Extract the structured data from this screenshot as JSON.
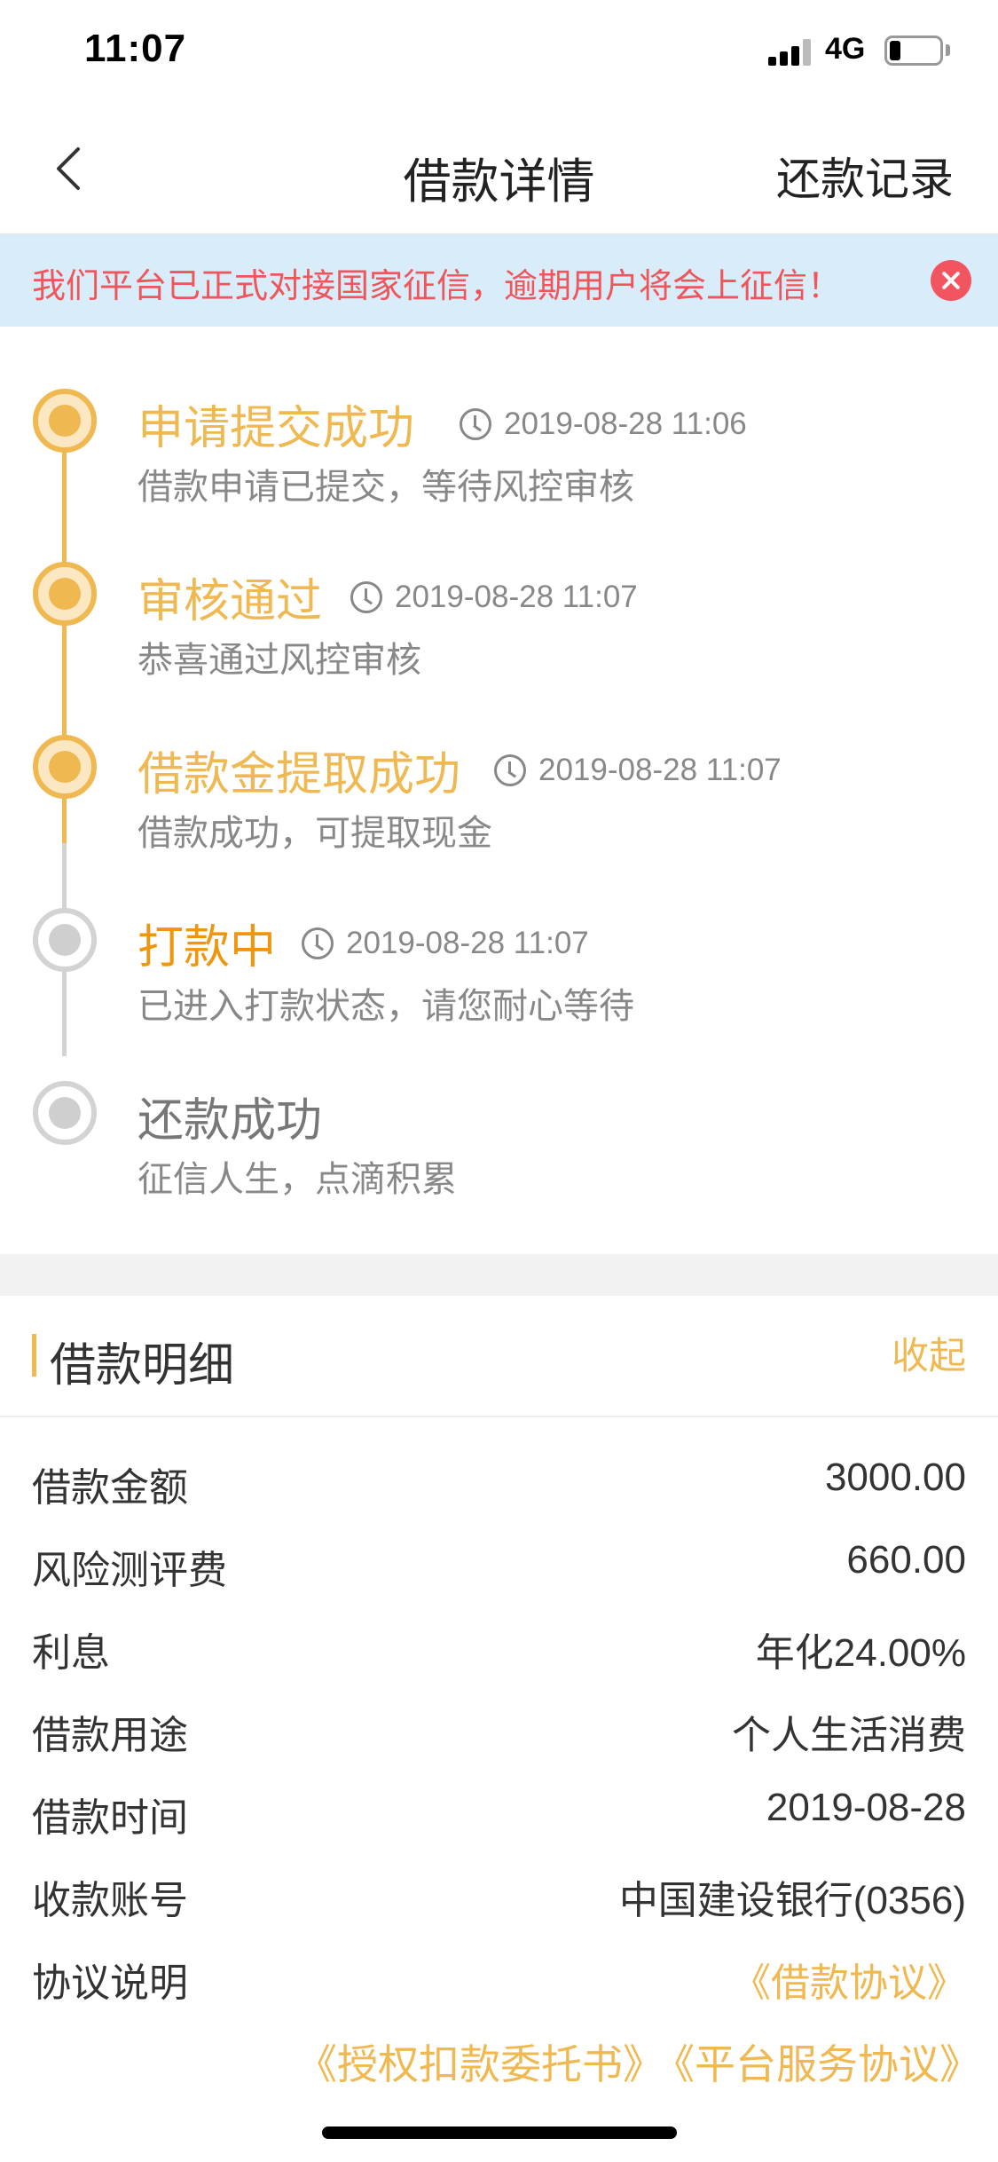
{
  "status_bar": {
    "time": "11:07",
    "network": "4G"
  },
  "nav": {
    "title": "借款详情",
    "right_action": "还款记录"
  },
  "notice": {
    "text": "我们平台已正式对接国家征信，逾期用户将会上征信！"
  },
  "timeline": [
    {
      "title": "申请提交成功",
      "time": "2019-08-28 11:06",
      "desc": "借款申请已提交，等待风控审核",
      "state": "done"
    },
    {
      "title": "审核通过",
      "time": "2019-08-28 11:07",
      "desc": "恭喜通过风控审核",
      "state": "done"
    },
    {
      "title": "借款金提取成功",
      "time": "2019-08-28 11:07",
      "desc": "借款成功，可提取现金",
      "state": "done"
    },
    {
      "title": "打款中",
      "time": "2019-08-28 11:07",
      "desc": "已进入打款状态，请您耐心等待",
      "state": "active"
    },
    {
      "title": "还款成功",
      "time": "",
      "desc": "征信人生，点滴积累",
      "state": "pending"
    }
  ],
  "details": {
    "title": "借款明细",
    "collapse_label": "收起",
    "rows": [
      {
        "label": "借款金额",
        "value": "3000.00"
      },
      {
        "label": "风险测评费",
        "value": "660.00"
      },
      {
        "label": "利息",
        "value": "年化24.00%"
      },
      {
        "label": "借款用途",
        "value": "个人生活消费"
      },
      {
        "label": "借款时间",
        "value": "2019-08-28"
      },
      {
        "label": "收款账号",
        "value": "中国建设银行(0356)"
      },
      {
        "label": "协议说明",
        "value": "《借款协议》"
      }
    ],
    "agreements": [
      "《授权扣款委托书》",
      "《平台服务协议》"
    ]
  },
  "colors": {
    "accent": "#f0b850",
    "active": "#f0960e",
    "notice_bg": "#d9ecfa",
    "notice_text": "#f0555a"
  }
}
